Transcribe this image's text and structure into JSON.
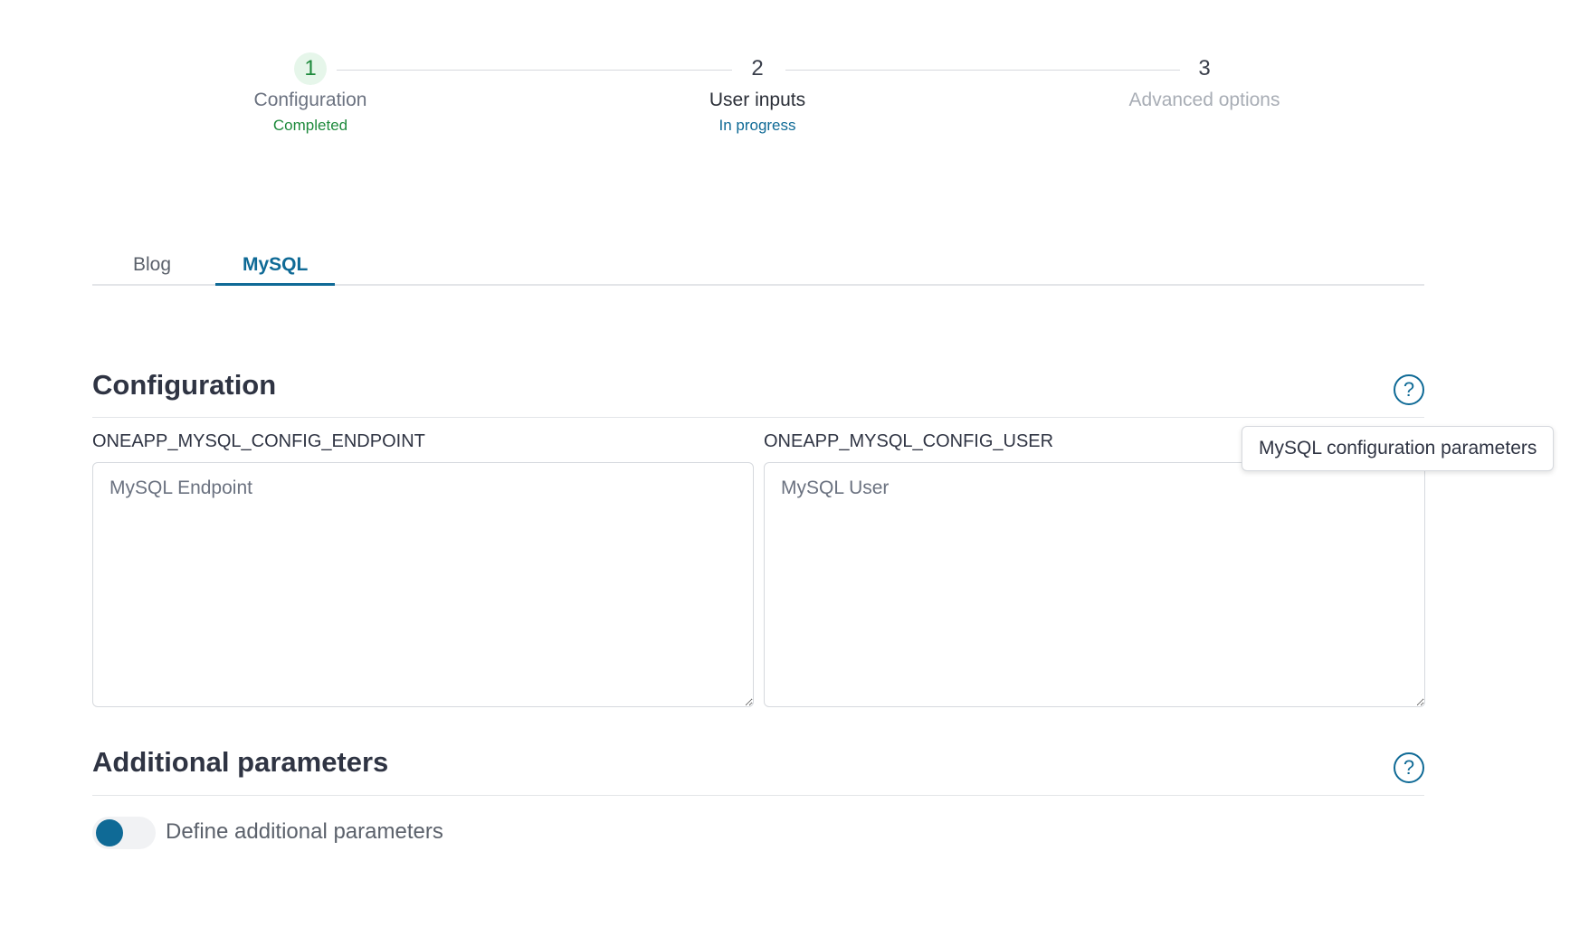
{
  "stepper": {
    "steps": [
      {
        "number": "1",
        "title": "Configuration",
        "status": "Completed"
      },
      {
        "number": "2",
        "title": "User inputs",
        "status": "In progress"
      },
      {
        "number": "3",
        "title": "Advanced options",
        "status": ""
      }
    ]
  },
  "tabs": [
    {
      "label": "Blog",
      "active": false
    },
    {
      "label": "MySQL",
      "active": true
    }
  ],
  "configuration": {
    "title": "Configuration",
    "help_icon": "question-circle-icon",
    "tooltip": "MySQL configuration parameters",
    "fields": [
      {
        "label": "ONEAPP_MYSQL_CONFIG_ENDPOINT",
        "placeholder": "MySQL Endpoint",
        "value": ""
      },
      {
        "label": "ONEAPP_MYSQL_CONFIG_USER",
        "placeholder": "MySQL User",
        "value": ""
      }
    ]
  },
  "additional": {
    "title": "Additional parameters",
    "help_icon": "question-circle-icon",
    "toggle_label": "Define additional parameters"
  },
  "colors": {
    "accent": "#0f6a96",
    "completed": "#1e8a3c",
    "muted": "#a8adb5"
  }
}
